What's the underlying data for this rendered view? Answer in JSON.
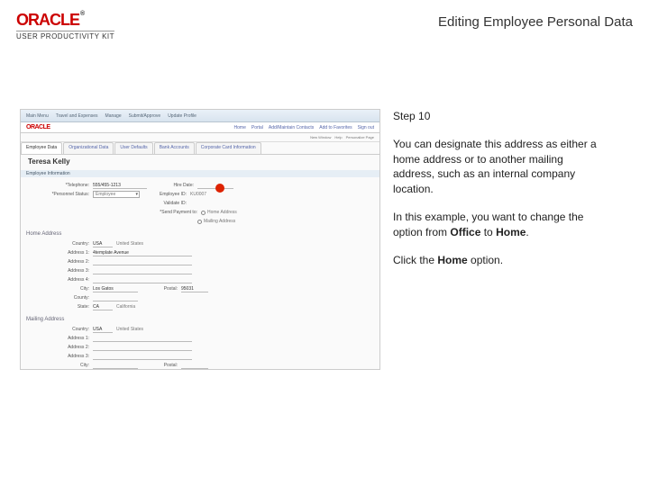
{
  "header": {
    "brand": "ORACLE",
    "brand_sub": "USER PRODUCTIVITY KIT",
    "title": "Editing Employee Personal Data"
  },
  "instructions": {
    "step_label": "Step 10",
    "p1": "You can designate this address as either a home address or to another mailing address, such as an internal company location.",
    "p2_before": "In this example, you want to change the option from ",
    "p2_bold1": "Office",
    "p2_mid": " to ",
    "p2_bold2": "Home",
    "p2_after": ".",
    "p3_before": "Click the ",
    "p3_bold": "Home",
    "p3_after": " option."
  },
  "screenshot": {
    "top_items": [
      "Main Menu",
      "Travel and Expenses",
      "Manage",
      "Submit/Approve",
      "Update Profile"
    ],
    "logo": "ORACLE",
    "nav_items": [
      "Home",
      "Portal",
      "Add/Maintain Contacts",
      "Add to Favorites",
      "Sign out"
    ],
    "subbar": [
      "New Window",
      "Help",
      "Personalize Page"
    ],
    "tabs": [
      "Employee Data",
      "Organizational Data",
      "User Defaults",
      "Bank Accounts",
      "Corporate Card Information"
    ],
    "emp_name": "Teresa Kelly",
    "section1": "Employee Information",
    "fields": {
      "phone_label": "*Telephone:",
      "phone_val": "555/455-1213",
      "status_label": "*Personnel Status:",
      "status_val": "Employee",
      "hire_label": "Hire Date:",
      "emp_id_label": "Employee ID:",
      "emp_id_val": "KU0007",
      "valid_label": "Validate ID:",
      "radios_label": "*Send Payment to:",
      "radio1": "Home Address",
      "radio2": "Mailing Address"
    },
    "section2": "Home Address",
    "section3": "Mailing Address",
    "addr": {
      "country_label": "Country:",
      "country_val": "USA",
      "country_name": "United States",
      "addr1_label": "Address 1:",
      "addr1_val": "4template Avenue",
      "addr2_label": "Address 2:",
      "addr3_label": "Address 3:",
      "addr4_label": "Address 4:",
      "city_label": "City:",
      "city_val": "Los Gatos",
      "county_label": "County:",
      "state_label": "State:",
      "state_val": "CA",
      "state_name": "California",
      "postal_label": "Postal:",
      "postal_val": "95031"
    },
    "addr2": {
      "country_val": "USA",
      "country_name": "United States"
    }
  }
}
